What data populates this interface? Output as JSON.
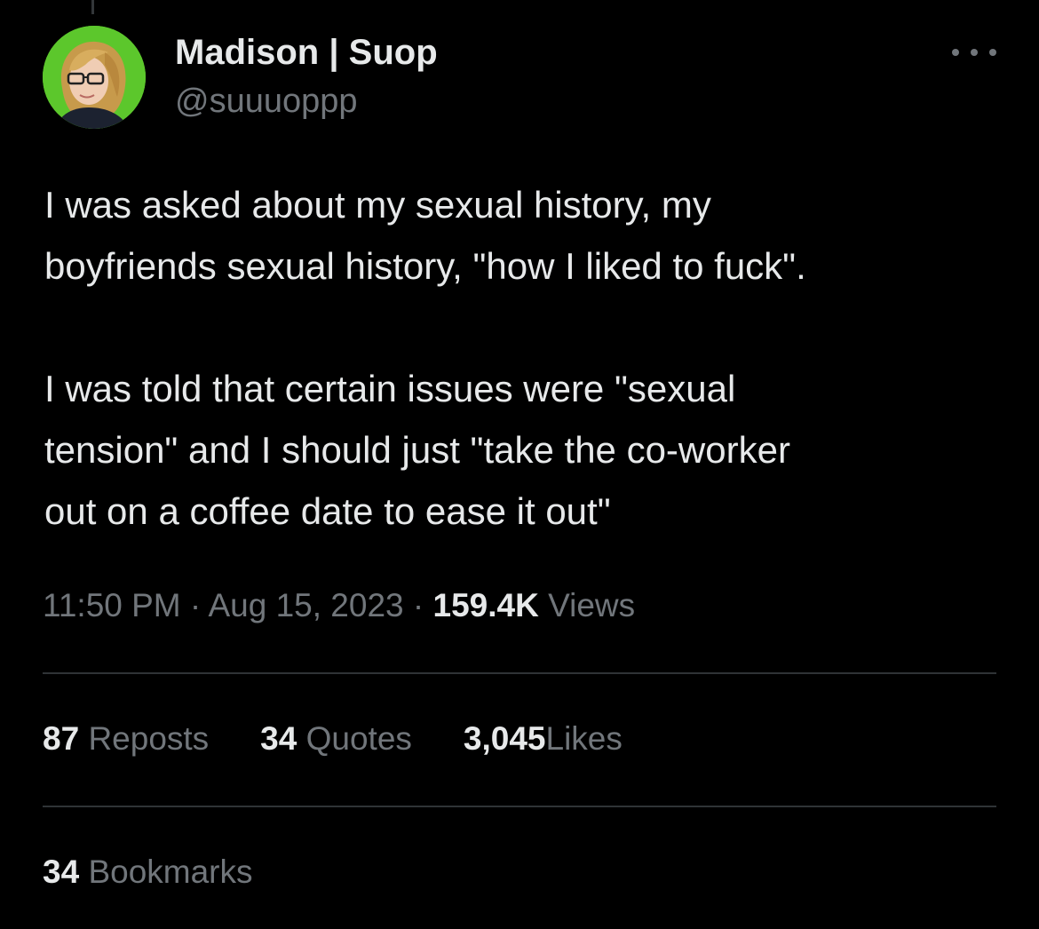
{
  "author": {
    "display_name": "Madison | Suop",
    "handle": "@suuuoppp",
    "avatar_icon": "profile-photo-avatar"
  },
  "tweet": {
    "lines_paragraph_1": [
      "I was asked about my sexual history, my",
      "boyfriends sexual history, \"how I liked to fuck\"."
    ],
    "lines_paragraph_2": [
      "I was told that certain issues were \"sexual",
      "tension\" and I should just \"take the co-worker",
      "out on a coffee date to ease it out\""
    ]
  },
  "meta": {
    "time": "11:50 PM",
    "separator": " · ",
    "date": "Aug 15, 2023",
    "views_count": "159.4K",
    "views_label": "Views"
  },
  "stats": {
    "reposts_count": "87",
    "reposts_label": "Reposts",
    "quotes_count": "34",
    "quotes_label": "Quotes",
    "likes_count": "3,045",
    "likes_label": "Likes"
  },
  "bookmarks": {
    "count": "34",
    "label": "Bookmarks"
  },
  "colors": {
    "background": "#000000",
    "primary_text": "#e7e9ea",
    "secondary_text": "#71767b",
    "divider": "#2f3336",
    "avatar_bg": "#5cc72c"
  },
  "icons": {
    "more": "more-dots-icon"
  }
}
